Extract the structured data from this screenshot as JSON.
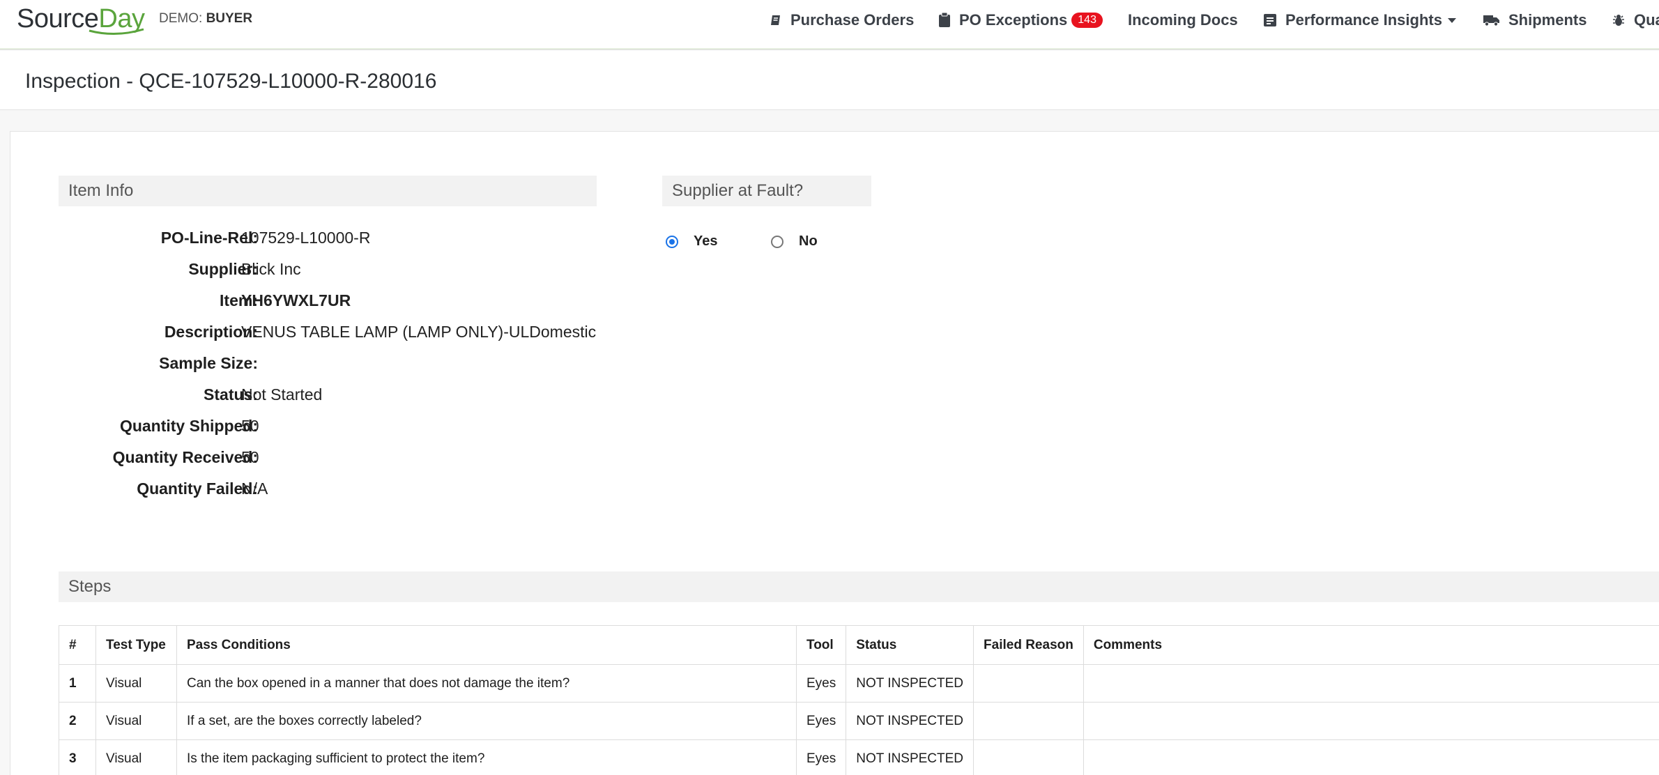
{
  "brand": {
    "name_part1": "Source",
    "name_part2": "Day",
    "demo_label": "DEMO:",
    "demo_role": "BUYER",
    "accent": "#5aa43c"
  },
  "nav": {
    "items": [
      {
        "label": "Purchase Orders",
        "icon": "book-icon"
      },
      {
        "label": "PO Exceptions",
        "icon": "clipboard-icon",
        "badge": "143"
      },
      {
        "label": "Incoming Docs",
        "icon": ""
      },
      {
        "label": "Performance Insights",
        "icon": "report-icon",
        "dropdown": true
      },
      {
        "label": "Shipments",
        "icon": "truck-icon"
      },
      {
        "label": "Qua",
        "icon": "bug-icon"
      }
    ]
  },
  "page": {
    "title": "Inspection - QCE-107529-L10000-R-280016"
  },
  "item_info": {
    "heading": "Item Info",
    "fields": [
      {
        "label": "PO-Line-Rel:",
        "value": "107529-L10000-R"
      },
      {
        "label": "Supplier:",
        "value": "Blick Inc"
      },
      {
        "label": "Item:",
        "value": "YH6YWXL7UR"
      },
      {
        "label": "Description:",
        "value": "VENUS TABLE LAMP (LAMP ONLY)-ULDomestic"
      },
      {
        "label": "Sample Size:",
        "value": ""
      },
      {
        "label": "Status:",
        "value": "Not Started"
      },
      {
        "label": "Quantity Shipped:",
        "value": "50"
      },
      {
        "label": "Quantity Received:",
        "value": "50"
      },
      {
        "label": "Quantity Failed:",
        "value": "N/A"
      }
    ]
  },
  "supplier_fault": {
    "heading": "Supplier at Fault?",
    "options": [
      {
        "label": "Yes",
        "selected": true
      },
      {
        "label": "No",
        "selected": false
      }
    ]
  },
  "steps": {
    "heading": "Steps",
    "columns": [
      "#",
      "Test Type",
      "Pass Conditions",
      "Tool",
      "Status",
      "Failed Reason",
      "Comments"
    ],
    "rows": [
      {
        "num": "1",
        "test_type": "Visual",
        "pass_conditions": "Can the box opened in a manner that does not damage the item?",
        "tool": "Eyes",
        "status": "NOT INSPECTED",
        "failed_reason": "",
        "comments": ""
      },
      {
        "num": "2",
        "test_type": "Visual",
        "pass_conditions": "If a set, are the boxes correctly labeled?",
        "tool": "Eyes",
        "status": "NOT INSPECTED",
        "failed_reason": "",
        "comments": ""
      },
      {
        "num": "3",
        "test_type": "Visual",
        "pass_conditions": "Is the item packaging sufficient to protect the item?",
        "tool": "Eyes",
        "status": "NOT INSPECTED",
        "failed_reason": "",
        "comments": ""
      }
    ]
  }
}
